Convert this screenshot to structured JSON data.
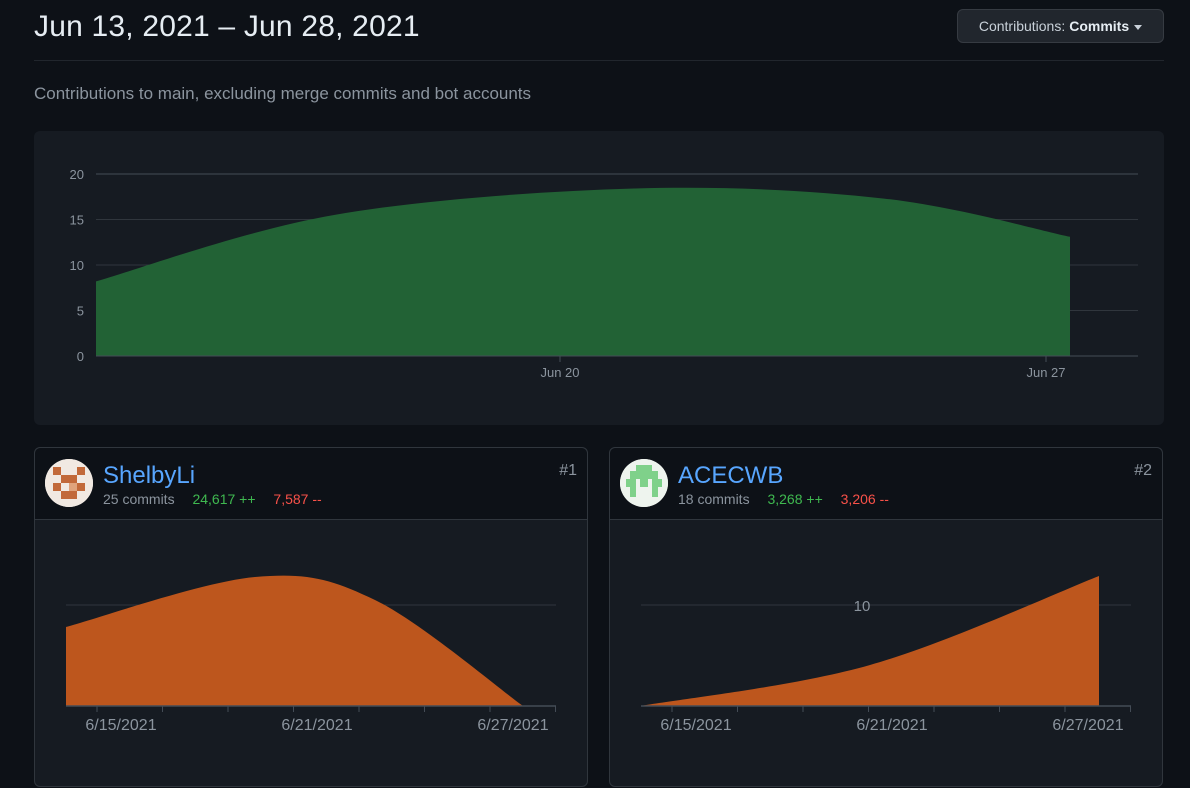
{
  "header": {
    "date_range": "Jun 13, 2021 – Jun 28, 2021",
    "contrib_label": "Contributions:",
    "contrib_value": "Commits"
  },
  "subtitle": "Contributions to main, excluding merge commits and bot accounts",
  "colors": {
    "main_fill": "#226235",
    "card_fill": "#bd561d",
    "adds": "#3fb950",
    "dels": "#f85149",
    "link": "#58a6ff"
  },
  "chart_data": [
    {
      "type": "area",
      "y_ticks": [
        "0",
        "5",
        "10",
        "15",
        "20"
      ],
      "x_tick_labels": [
        "Jun 20",
        "Jun 27"
      ],
      "ylim": [
        0,
        20
      ],
      "series": [
        {
          "values": [
            8.2,
            15.5,
            18.4,
            17.3,
            13.1
          ]
        }
      ]
    },
    {
      "type": "area",
      "x_tick_labels": [
        "6/15/2021",
        "6/21/2021",
        "6/27/2021"
      ],
      "series": [
        {
          "values": [
            7.9,
            12.9,
            10.6,
            0
          ]
        }
      ]
    },
    {
      "type": "area",
      "y_tick_labels": [
        "10"
      ],
      "x_tick_labels": [
        "6/15/2021",
        "6/21/2021",
        "6/27/2021"
      ],
      "series": [
        {
          "values": [
            0,
            4.1,
            13.0
          ]
        }
      ]
    }
  ],
  "contributors": [
    {
      "name": "ShelbyLi",
      "commits": "25 commits",
      "additions": "24,617 ++",
      "deletions": "7,587 --",
      "rank": "#1"
    },
    {
      "name": "ACECWB",
      "commits": "18 commits",
      "additions": "3,268 ++",
      "deletions": "3,206 --",
      "rank": "#2"
    }
  ]
}
